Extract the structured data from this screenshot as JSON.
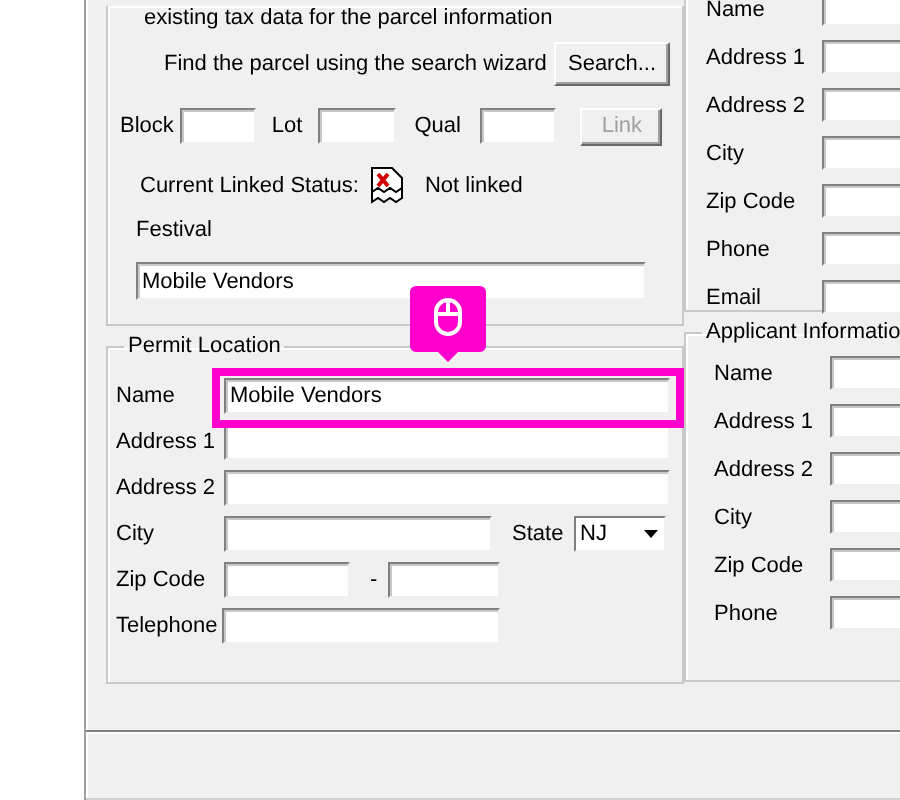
{
  "parcel_section": {
    "note": "existing tax data for the parcel information",
    "search_prompt": "Find the parcel using the search wizard",
    "search_button": "Search...",
    "block_label": "Block",
    "lot_label": "Lot",
    "qual_label": "Qual",
    "link_button": {
      "label": "Link",
      "disabled": true
    },
    "status_label": "Current Linked Status:",
    "status": "Not linked",
    "festival_label": "Festival",
    "festival_value": "Mobile Vendors"
  },
  "permit_location": {
    "title": "Permit Location",
    "name": {
      "label": "Name",
      "value": "Mobile Vendors",
      "highlighted": true
    },
    "address_1": "Address 1",
    "address_2": "Address 2",
    "city": "City",
    "state_label": "State",
    "state_value": "NJ",
    "zip_label": "Zip Code",
    "zip_separator": "-",
    "telephone": "Telephone"
  },
  "contact_section": {
    "labels": [
      "Name",
      "Address 1",
      "Address 2",
      "City",
      "Zip Code",
      "Phone",
      "Email"
    ]
  },
  "applicant_information": {
    "title": "Applicant Informatio",
    "labels": [
      "Name",
      "Address 1",
      "Address 2",
      "City",
      "Zip Code",
      "Phone"
    ]
  }
}
